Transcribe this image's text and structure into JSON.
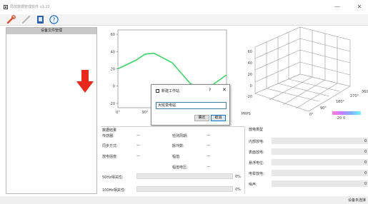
{
  "window": {
    "title": "局放数据管理软件 v1.22",
    "minimize_glyph": "—",
    "close_glyph": "✕",
    "icon": "app-window-icon"
  },
  "toolbar": {
    "buttons": [
      {
        "icon": "wrench-icon",
        "color": "#d94b2b"
      },
      {
        "icon": "pen-icon",
        "color": "#b8b8b8"
      },
      {
        "icon": "notebook-icon",
        "color": "#2a5fb0"
      },
      {
        "icon": "help-icon",
        "color": "#2a6fd0",
        "glyph": "?"
      }
    ]
  },
  "left_panel": {
    "header": "设备文件管理",
    "arrow_color": "#e8281c"
  },
  "chart_data": [
    {
      "type": "line",
      "x": [
        0,
        60,
        90,
        120,
        180,
        240,
        270,
        300,
        360
      ],
      "series": [
        {
          "values": [
            20,
            30,
            37,
            38,
            27,
            3,
            -3,
            -2,
            13
          ]
        }
      ],
      "xticks": [
        "0°",
        "90°"
      ],
      "yticks": [
        "60",
        "40",
        "20",
        "0",
        "-20"
      ],
      "ylim": [
        -25,
        65
      ],
      "line_color": "#3ad764"
    },
    {
      "type": "surface",
      "zticks": [
        "60",
        "40",
        "20",
        "0",
        "-20"
      ],
      "xticks": [
        "0°",
        "90°",
        "180°",
        "270°",
        "360°"
      ],
      "yticks": [
        "-20",
        "0"
      ],
      "xlabel": "",
      "corner_label": "PRPS",
      "colorbar_colors": [
        "#ff7bd8",
        "#c77bff",
        "#7ab3ff",
        "#76f3ff"
      ]
    }
  ],
  "dialog": {
    "title": "新建工作站",
    "help": "?",
    "close": "✕",
    "input_value": "大班变电站",
    "ok": "确定",
    "cancel": "取消"
  },
  "data_panel": {
    "title": "数据结果",
    "rows": [
      {
        "label1": "传感器:",
        "value1": "—",
        "label2": "检测周期:",
        "value2": "—"
      },
      {
        "label1": "同步方式:",
        "value1": "—",
        "label2": "脉冲数:",
        "value2": "—"
      },
      {
        "label1": "放电强度:",
        "value1": "—",
        "label2": "幅值:",
        "value2": "—"
      },
      {
        "label1": "",
        "value1": "",
        "label2": "幅值电压:",
        "value2": "—"
      }
    ],
    "corr50": {
      "label": "50Hz相关性:",
      "percent": "0%",
      "level": 0
    },
    "corr100": {
      "label": "100Hz相关性:",
      "percent": "0%",
      "level": 0
    }
  },
  "discharge_panel": {
    "title": "放电类型",
    "rows": [
      {
        "label": "内部放电:",
        "suffix": "0"
      },
      {
        "label": "表面放电:",
        "suffix": "0"
      },
      {
        "label": "悬浮电位:",
        "suffix": "0"
      },
      {
        "label": "电晕放电:",
        "suffix": "0"
      },
      {
        "label": "噪声:",
        "suffix": "0"
      }
    ]
  },
  "status_bar": {
    "text": "设备未连接"
  }
}
